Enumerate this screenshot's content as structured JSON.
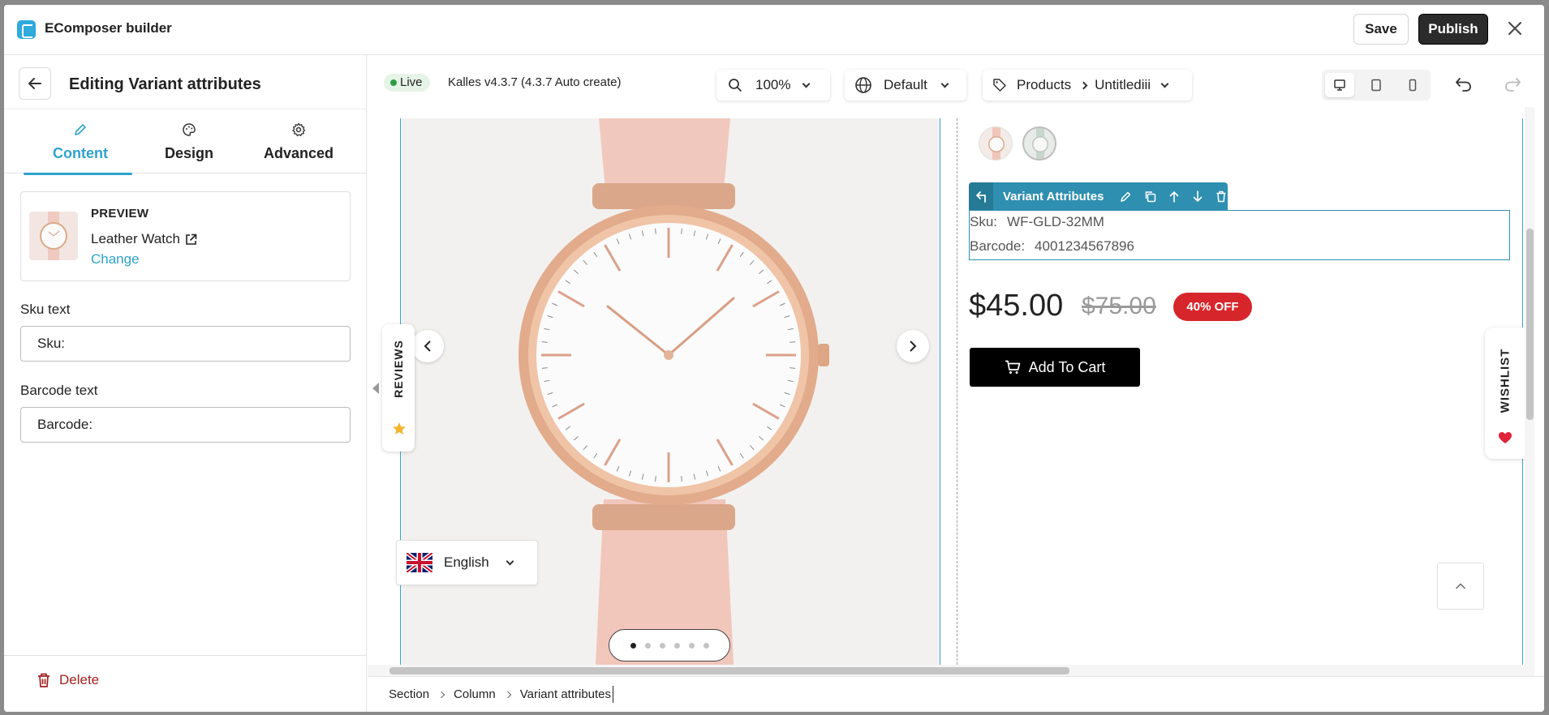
{
  "app": {
    "title": "EComposer builder"
  },
  "header": {
    "save_label": "Save",
    "publish_label": "Publish"
  },
  "panel": {
    "title": "Editing Variant attributes",
    "tabs": [
      {
        "label": "Content",
        "icon": "pencil-icon"
      },
      {
        "label": "Design",
        "icon": "palette-icon"
      },
      {
        "label": "Advanced",
        "icon": "gear-icon"
      }
    ],
    "preview": {
      "label": "PREVIEW",
      "product_name": "Leather Watch",
      "change_label": "Change"
    },
    "sku_field": {
      "label": "Sku text",
      "value": "Sku:"
    },
    "barcode_field": {
      "label": "Barcode text",
      "value": "Barcode:"
    },
    "delete_label": "Delete"
  },
  "toolbar": {
    "live_label": "Live",
    "theme": "Kalles v4.3.7 (4.3.7 Auto create)",
    "zoom": "100%",
    "language": "Default",
    "page_type": "Products",
    "page_name": "Untitlediii"
  },
  "canvas": {
    "reviews_label": "REVIEWS",
    "language_selector": "English",
    "carousel_dots": 6,
    "carousel_active": 0,
    "variant_toolbar_label": "Variant Attributes",
    "sku_key": "Sku:",
    "sku_value": "WF-GLD-32MM",
    "barcode_key": "Barcode:",
    "barcode_value": "4001234567896",
    "price": "$45.00",
    "compare_price": "$75.00",
    "discount_badge": "40% OFF",
    "add_to_cart": "Add To Cart",
    "wishlist_label": "WISHLIST"
  },
  "breadcrumb": [
    "Section",
    "Column",
    "Variant attributes"
  ],
  "colors": {
    "accent": "#2ea3cc",
    "variant_toolbar": "#2e8fb0",
    "badge": "#d7262b",
    "delete": "#a32020",
    "live_dot": "#2e9e45"
  }
}
